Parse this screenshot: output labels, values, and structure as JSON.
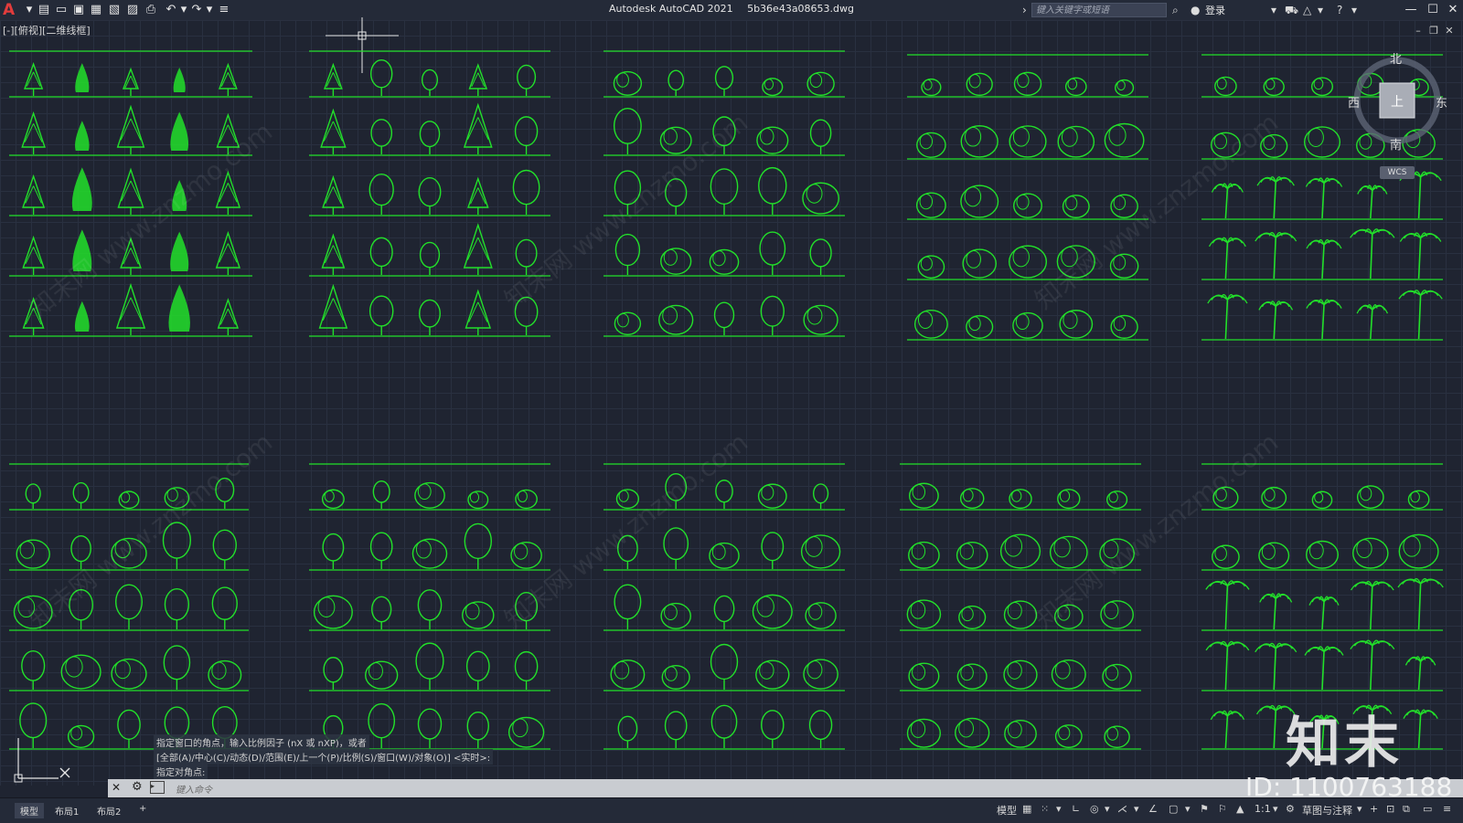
{
  "app": {
    "title": "Autodesk AutoCAD 2021",
    "filename": "5b36e43a08653.dwg",
    "search_placeholder": "键入关键字或短语",
    "login_label": "登录",
    "logo": "A"
  },
  "viewport": {
    "label": "[-][俯视][二维线框]"
  },
  "viewcube": {
    "north": "北",
    "south": "南",
    "east": "东",
    "west": "西",
    "top": "上",
    "wcs": "WCS"
  },
  "command": {
    "history": [
      "指定窗口的角点，输入比例因子 (nX 或 nXP)，或者",
      "[全部(A)/中心(C)/动态(D)/范围(E)/上一个(P)/比例(S)/窗口(W)/对象(O)] <实时>:",
      "指定对角点:"
    ],
    "input_placeholder": "键入命令"
  },
  "layout_tabs": [
    "模型",
    "布局1",
    "布局2",
    "+"
  ],
  "status": {
    "model_label": "模型",
    "scale": "1:1",
    "workspace": "草图与注释"
  },
  "watermark": {
    "logo_text": "知末",
    "id_text": "ID: 1100763188",
    "tiles": [
      "知末网 www.znzmo.com"
    ]
  },
  "colors": {
    "drawing": "#22e02a",
    "background": "#1f2431",
    "grid": "#293040"
  }
}
